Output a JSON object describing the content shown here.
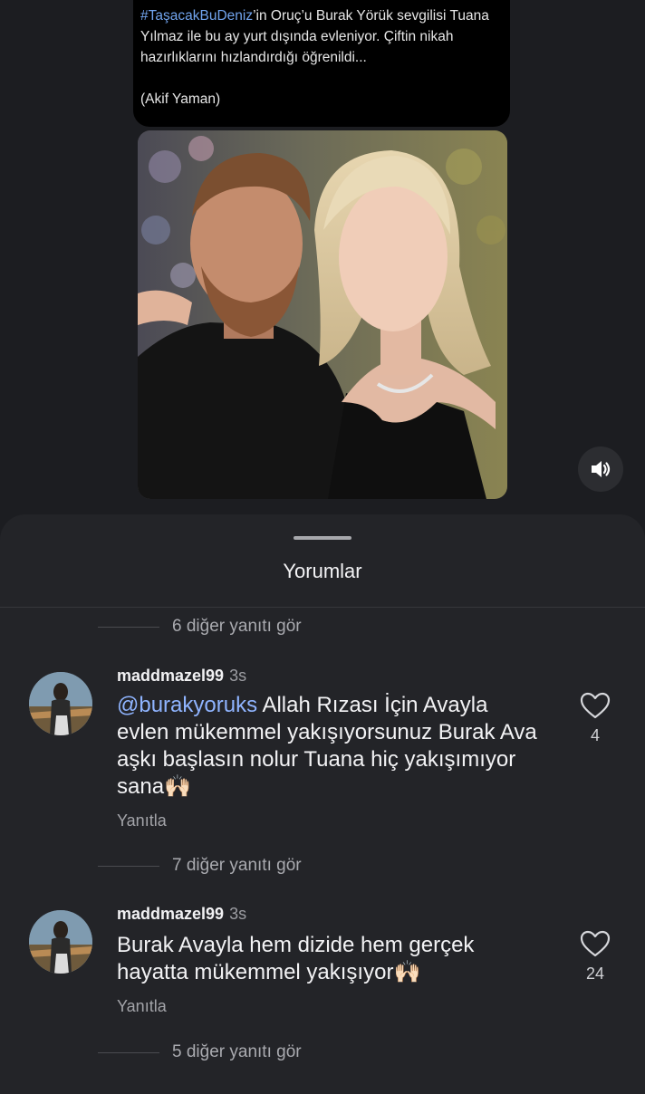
{
  "post": {
    "hashtag": "#TaşacakBuDeniz",
    "text": "’in Oruç’u Burak Yörük sevgilisi Tuana Yılmaz ile bu ay yurt dışında evleniyor. Çiftin nikah hazırlıklarını hızlandırdığı öğrenildi...",
    "author": "(Akif Yaman)"
  },
  "controls": {
    "mute_icon": "volume-icon"
  },
  "sheet": {
    "title": "Yorumlar"
  },
  "more_replies": [
    "6 diğer yanıtı gör",
    "7 diğer yanıtı gör",
    "5 diğer yanıtı gör"
  ],
  "comments": [
    {
      "username": "maddmazel99",
      "time": "3s",
      "mention": "@burakyoruks",
      "text": " Allah Rızası İçin Avayla evlen mükemmel yakışıyorsunuz Burak Ava aşkı başlasın nolur Tuana hiç yakışımıyor sana🙌🏻",
      "reply_label": "Yanıtla",
      "likes": "4"
    },
    {
      "username": "maddmazel99",
      "time": "3s",
      "mention": "",
      "text": "Burak Avayla hem dizide hem gerçek hayatta mükemmel yakışıyor🙌🏻",
      "reply_label": "Yanıtla",
      "likes": "24"
    }
  ],
  "colors": {
    "background": "#1c1d21",
    "sheet": "#232428",
    "mention": "#8fb4ff",
    "hashtag": "#71a4ee"
  }
}
